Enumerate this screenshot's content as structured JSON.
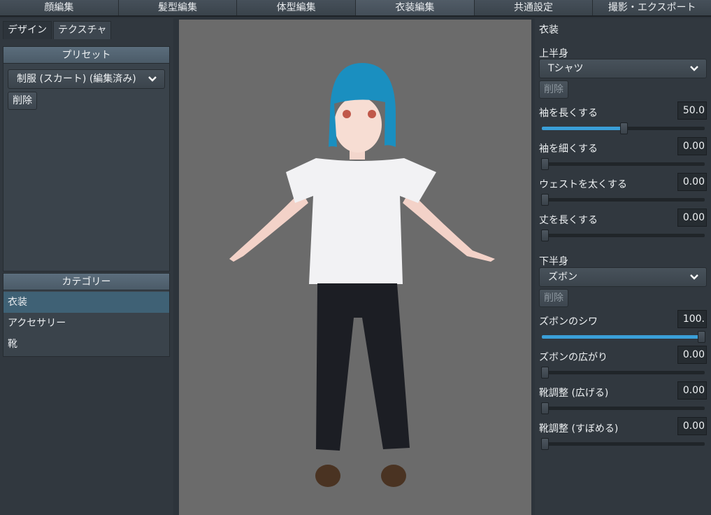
{
  "top_tabs": [
    "顔編集",
    "髪型編集",
    "体型編集",
    "衣装編集",
    "共通設定",
    "撮影・エクスポート"
  ],
  "active_top_tab": 3,
  "left": {
    "subtabs": [
      "デザイン",
      "テクスチャ"
    ],
    "preset": {
      "header": "プリセット",
      "selected": "制服 (スカート) (編集済み)",
      "delete_label": "削除"
    },
    "category": {
      "header": "カテゴリー",
      "items": [
        "衣装",
        "アクセサリー",
        "靴"
      ],
      "selected_index": 0
    }
  },
  "right": {
    "title": "衣装",
    "upper": {
      "label": "上半身",
      "selected": "Tシャツ",
      "delete_label": "削除",
      "sliders": [
        {
          "name": "袖を長くする",
          "value": "50.0",
          "fraction": 0.5
        },
        {
          "name": "袖を細くする",
          "value": "0.00",
          "fraction": 0
        },
        {
          "name": "ウェストを太くする",
          "value": "0.00",
          "fraction": 0
        },
        {
          "name": "丈を長くする",
          "value": "0.00",
          "fraction": 0
        }
      ]
    },
    "lower": {
      "label": "下半身",
      "selected": "ズボン",
      "delete_label": "削除",
      "sliders": [
        {
          "name": "ズボンのシワ",
          "value": "100.",
          "fraction": 1.0
        },
        {
          "name": "ズボンの広がり",
          "value": "0.00",
          "fraction": 0
        },
        {
          "name": "靴調整 (広げる)",
          "value": "0.00",
          "fraction": 0
        },
        {
          "name": "靴調整 (すぼめる)",
          "value": "0.00",
          "fraction": 0
        }
      ]
    }
  },
  "colors": {
    "accent": "#3a9fd8",
    "hair": "#1a8fc0",
    "shirt": "#f2f2f4",
    "pants": "#1c1e24",
    "viewport_bg": "#6b6b6b"
  }
}
